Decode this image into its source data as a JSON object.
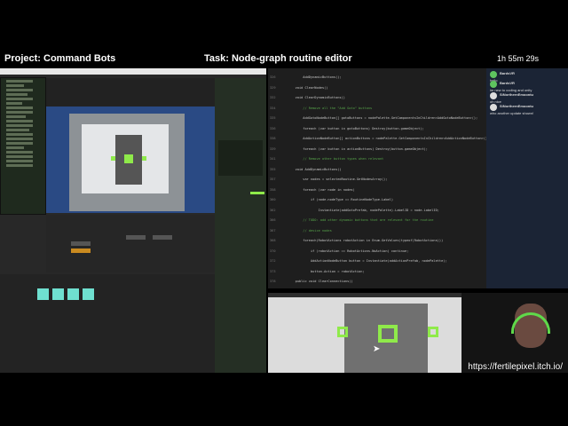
{
  "overlay": {
    "project": "Project: Command Bots",
    "task": "Task: Node-graph routine editor",
    "timer": "1h 55m 29s",
    "url": "https://fertilepixel.itch.io/"
  },
  "code": {
    "lines": [
      {
        "n": "326",
        "t": "        AddDynamicButtons();"
      },
      {
        "n": "329",
        "t": "    void ClearNodes()"
      },
      {
        "n": "332",
        "t": "    void ClearDynamicButtons()"
      },
      {
        "n": "334",
        "t": "        // Remove all the \"Add Goto\" buttons"
      },
      {
        "n": "335",
        "t": "        AddGotoNodeButton[] gotoButtons = nodePalette.GetComponentsInChildren<AddGotoNodeButton>();"
      },
      {
        "n": "336",
        "t": "        foreach (var button in gotoButtons) Destroy(button.gameObject);"
      },
      {
        "n": "338",
        "t": "        AddActionNodeButton[] actionButtons = nodePalette.GetComponentsInChildren<AddActionNodeButton>();"
      },
      {
        "n": "339",
        "t": "        foreach (var button in actionButtons) Destroy(button.gameObject);"
      },
      {
        "n": "341",
        "t": "        // Remove other button types when relevant"
      },
      {
        "n": "355",
        "t": "    void AddDynamicButtons()"
      },
      {
        "n": "357",
        "t": "        var nodes = selectedRoutine.GetNodesArray();"
      },
      {
        "n": "358",
        "t": "        foreach (var node in nodes)"
      },
      {
        "n": "360",
        "t": "            if (node.nodeType == RoutineNodeType.Label)"
      },
      {
        "n": "362",
        "t": "                Instantiate(addGotoPrefab, nodePalette).LabelID = node.LabelID;"
      },
      {
        "n": "366",
        "t": "        // TODO: add other dynamic buttons that are relevant for the routine"
      },
      {
        "n": "367",
        "t": "        // device nodes"
      },
      {
        "n": "368",
        "t": "        foreach(RobotActions robotAction in Enum.GetValues(typeof(RobotActions)))"
      },
      {
        "n": "370",
        "t": "            if (robotAction == RobotActions.NoAction) continue;"
      },
      {
        "n": "372",
        "t": "            AddActionNodeButton button = Instantiate(addActionPrefab, nodePalette);"
      },
      {
        "n": "373",
        "t": "            button.Action = robotAction;"
      },
      {
        "n": "378",
        "t": "    public void ClearConnections()"
      }
    ]
  },
  "chat": {
    "messages": [
      {
        "user": "BardsVR",
        "text": "hello"
      },
      {
        "user": "BardsVR",
        "text": "im new to coding and unity"
      },
      {
        "user": "SiNorthernEmoontu",
        "text": "oh nice"
      },
      {
        "user": "SiNorthernEmoontu",
        "text": "who another update shown!"
      }
    ]
  }
}
